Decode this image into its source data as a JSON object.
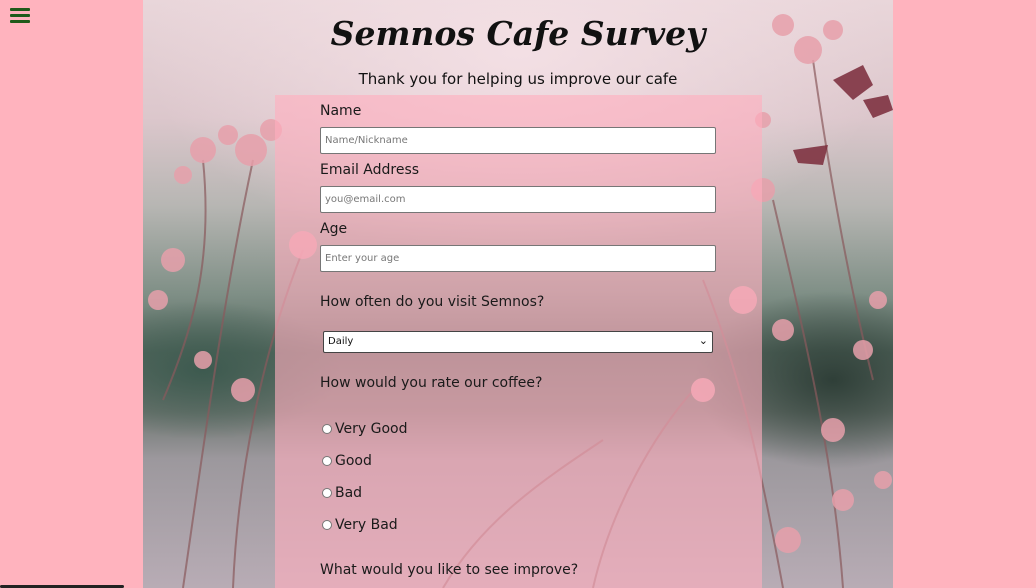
{
  "menu": {
    "icon": "hamburger-menu-icon"
  },
  "page": {
    "title": "Semnos Cafe Survey",
    "subtitle": "Thank you for helping us improve our cafe"
  },
  "form": {
    "name": {
      "label": "Name",
      "placeholder": "Name/Nickname"
    },
    "email": {
      "label": "Email Address",
      "placeholder": "you@email.com"
    },
    "age": {
      "label": "Age",
      "placeholder": "Enter your age"
    },
    "visit": {
      "question": "How often do you visit Semnos?",
      "selected": "Daily"
    },
    "rating": {
      "question": "How would you rate our coffee?",
      "options": [
        "Very Good",
        "Good",
        "Bad",
        "Very Bad"
      ]
    },
    "improve": {
      "question": "What would you like to see improve?"
    }
  },
  "colors": {
    "page_background": "#ffb3be",
    "menu_icon": "#1f5a1a"
  }
}
